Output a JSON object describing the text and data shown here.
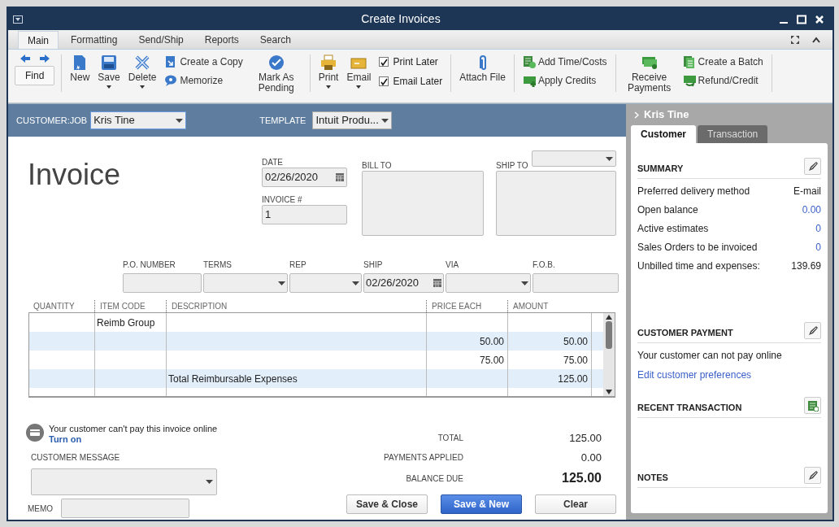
{
  "window": {
    "title": "Create Invoices"
  },
  "ribbon_tabs": [
    {
      "label": "Main",
      "selected": true
    },
    {
      "label": "Formatting",
      "selected": false
    },
    {
      "label": "Send/Ship",
      "selected": false
    },
    {
      "label": "Reports",
      "selected": false
    },
    {
      "label": "Search",
      "selected": false
    }
  ],
  "toolbar": {
    "find": "Find",
    "groups": [
      [
        {
          "kind": "big",
          "label": "New",
          "dropdown": false
        },
        {
          "kind": "big",
          "label": "Save",
          "dropdown": true
        },
        {
          "kind": "big",
          "label": "Delete",
          "dropdown": true
        },
        {
          "kind": "stack",
          "items": [
            "Create a Copy",
            "Memorize"
          ]
        },
        {
          "kind": "big",
          "label": "Mark As Pending",
          "dropdown": false
        }
      ],
      [
        {
          "kind": "big",
          "label": "Print",
          "dropdown": true
        },
        {
          "kind": "big",
          "label": "Email",
          "dropdown": true
        },
        {
          "kind": "checks",
          "items": [
            {
              "label": "Print Later",
              "checked": true
            },
            {
              "label": "Email Later",
              "checked": true
            }
          ]
        }
      ],
      [
        {
          "kind": "big",
          "label": "Attach File",
          "dropdown": false
        }
      ],
      [
        {
          "kind": "stack",
          "items": [
            "Add Time/Costs",
            "Apply Credits"
          ]
        }
      ],
      [
        {
          "kind": "big",
          "label": "Receive Payments",
          "dropdown": false
        },
        {
          "kind": "stack",
          "items": [
            "Create a Batch",
            "Refund/Credit"
          ]
        }
      ]
    ]
  },
  "header": {
    "customer_job": {
      "label": "CUSTOMER:JOB",
      "value": "Kris Tine"
    },
    "template": {
      "label": "TEMPLATE",
      "value": "Intuit Produ..."
    }
  },
  "form": {
    "title": "Invoice",
    "date": {
      "label": "DATE",
      "value": "02/26/2020"
    },
    "invoice_no": {
      "label": "INVOICE #",
      "value": "1"
    },
    "bill_to": {
      "label": "BILL TO"
    },
    "ship_to": {
      "label": "SHIP TO"
    },
    "fields": [
      {
        "kind": "text",
        "label": "P.O. NUMBER"
      },
      {
        "kind": "dropdown",
        "label": "TERMS"
      },
      {
        "kind": "dropdown",
        "label": "REP"
      },
      {
        "kind": "date",
        "label": "SHIP",
        "value": "02/26/2020"
      },
      {
        "kind": "dropdown",
        "label": "VIA"
      },
      {
        "kind": "text",
        "label": "F.O.B."
      }
    ]
  },
  "table": {
    "columns": [
      "QUANTITY",
      "ITEM CODE",
      "DESCRIPTION",
      "PRICE EACH",
      "AMOUNT"
    ],
    "rows": [
      [
        "",
        "Reimb Group",
        "",
        "",
        ""
      ],
      [
        "",
        "",
        "",
        "50.00",
        "50.00"
      ],
      [
        "",
        "",
        "",
        "75.00",
        "75.00"
      ],
      [
        "",
        "",
        "Total Reimbursable Expenses",
        "",
        "125.00"
      ],
      [
        "",
        "",
        "",
        "",
        ""
      ]
    ]
  },
  "online_payment": {
    "text": "Your customer can't pay this invoice online",
    "link": "Turn on"
  },
  "customer_message": {
    "label": "CUSTOMER MESSAGE"
  },
  "memo": {
    "label": "MEMO"
  },
  "totals": [
    {
      "label": "TOTAL",
      "value": "125.00",
      "emphasis": false
    },
    {
      "label": "PAYMENTS APPLIED",
      "value": "0.00",
      "emphasis": false
    },
    {
      "label": "BALANCE DUE",
      "value": "125.00",
      "emphasis": true
    }
  ],
  "buttons": [
    {
      "label": "Save & Close",
      "primary": false
    },
    {
      "label": "Save & New",
      "primary": true
    },
    {
      "label": "Clear",
      "primary": false
    }
  ],
  "side_panel": {
    "name": "Kris Tine",
    "tabs": [
      {
        "label": "Customer",
        "selected": true
      },
      {
        "label": "Transaction",
        "selected": false
      }
    ],
    "sections": [
      {
        "title": "SUMMARY",
        "kind": "edit",
        "rows": [
          {
            "label": "Preferred delivery method",
            "value": "E-mail",
            "link": false
          },
          {
            "label": "Open balance",
            "value": "0.00",
            "link": true
          },
          {
            "label": "Active estimates",
            "value": "0",
            "link": true
          },
          {
            "label": "Sales Orders to be invoiced",
            "value": "0",
            "link": true
          },
          {
            "label": "Unbilled time and expenses:",
            "value": "139.69",
            "link": false
          }
        ]
      },
      {
        "title": "CUSTOMER PAYMENT",
        "kind": "edit",
        "text": "Your customer can not pay online",
        "link": "Edit customer preferences"
      },
      {
        "title": "RECENT TRANSACTION",
        "kind": "report"
      },
      {
        "title": "NOTES",
        "kind": "edit"
      }
    ]
  }
}
